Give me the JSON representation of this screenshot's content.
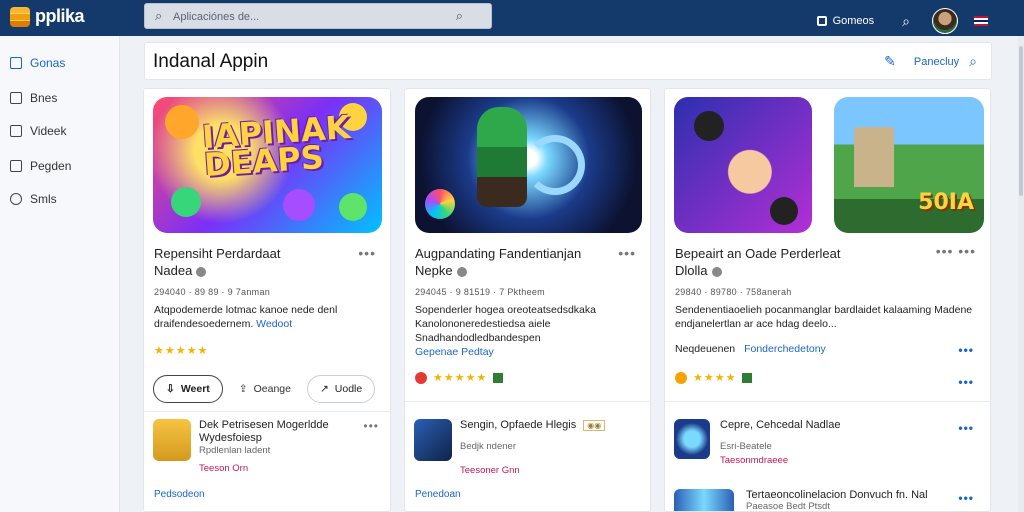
{
  "topbar": {
    "logo_text": "pplika",
    "search_placeholder": "Aplicaciónes de...",
    "games_label": "Gomeos"
  },
  "sidebar": {
    "items": [
      {
        "label": "Gonas",
        "icon": "grid-icon",
        "active": true
      },
      {
        "label": "Bnes",
        "icon": "square-icon"
      },
      {
        "label": "Videek",
        "icon": "video-icon"
      },
      {
        "label": "Pegden",
        "icon": "page-icon"
      },
      {
        "label": "Smls",
        "icon": "user-icon"
      }
    ]
  },
  "header": {
    "title": "Indanal Appin",
    "action_label": "Panecluy"
  },
  "col1": {
    "hero_text": "IAPINAK DEAPS",
    "title_line1": "Repensiht Perdardaat",
    "title_line2": "Nadea",
    "meta": "294040 · 89 89 · 9 7anman",
    "desc": "Atqpodemerde lotmac kanoe nede denl draifendesoedernem.",
    "desc_link": "Wedoot",
    "stars": "★★★★★",
    "btn_primary": "Weert",
    "btn_secondary": "Oeange",
    "btn_tertiary": "Uodle",
    "sub": {
      "title": "Dek Petrisesen Mogerldde Wydesfoiesp",
      "subtitle": "Rpdlenlan ladent",
      "foot": "Teeson Orn",
      "dev": "Pedsodeon"
    }
  },
  "col2": {
    "title_line1": "Augpandating Fandentianjan",
    "title_line2": "Nepke",
    "meta": "294045 · 9 81519 · 7 Pktheem",
    "desc": "Sopenderler hogea oreoteatsedsdkaka Kanolononeredestiedsa aiele Snadhandodledbandespen",
    "desc_link": "Gepenae Pedtay",
    "stars": "★★★★★",
    "sub": {
      "title": "Sengin, Opfaede Hlegis",
      "badge": "◉◉",
      "subtitle": "Bedjk ndener",
      "foot": "Teesoner Gnn",
      "dev": "Penedoan"
    }
  },
  "col3": {
    "hero_score": "50IA",
    "title_line1": "Bepeairt an Oade Perderleat",
    "title_line2": "Dlolla",
    "meta": "29840 · 89780 · 758anerah",
    "desc": "Sendenentiaoelieh pocanmanglar bardlaidet kalaaming Madene endjanelertlan ar ace hdag deelo...",
    "extra_label": "Neqdeuenen",
    "extra_link": "Fonderchedetony",
    "stars": "★★★★",
    "sub1": {
      "title": "Cepre, Cehcedal Nadlae",
      "subtitle": "Esri-Beatele",
      "foot": "Taesonmdraeee"
    },
    "sub2": {
      "title": "Tertaeoncolinelacion Donvuch fn. Nal",
      "subtitle": "Paeasoe Bedt Ptsdt"
    }
  }
}
